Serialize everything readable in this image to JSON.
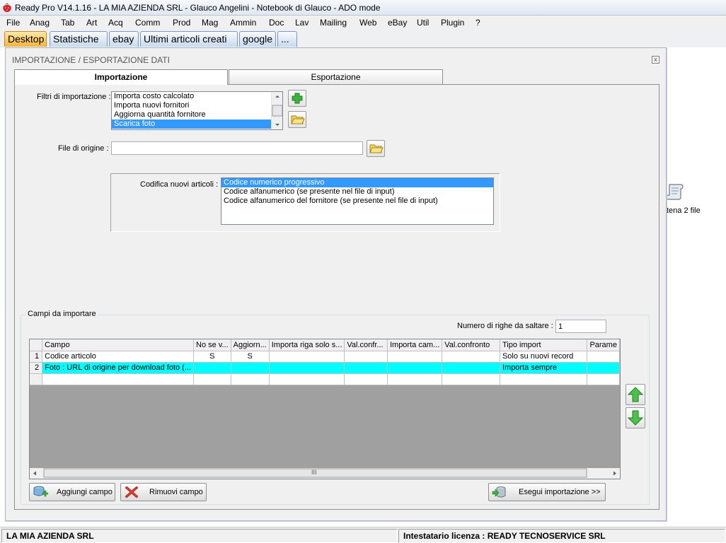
{
  "window": {
    "title": "Ready Pro V14.1.16 - LA MIA AZIENDA SRL - Glauco Angelini - Notebook di Glauco - ADO mode"
  },
  "menu": [
    "File",
    "Anag",
    "Tab",
    "Art",
    "Acq",
    "Comm",
    "Prod",
    "Mag",
    "Ammin",
    "Doc",
    "Lav",
    "Mailing",
    "Web",
    "eBay",
    "Util",
    "Plugin",
    "?"
  ],
  "desktop_tabs": [
    "Desktop",
    "Statistiche",
    "ebay",
    "Ultimi articoli creati",
    "google",
    "..."
  ],
  "desktop_item": {
    "label": "tena 2 file"
  },
  "dialog": {
    "title": "IMPORTAZIONE / ESPORTAZIONE DATI",
    "close": "x",
    "tabs": [
      "Importazione",
      "Esportazione"
    ],
    "filters": {
      "label": "Filtri di importazione :",
      "items": [
        "Importa costo calcolato",
        "Importa nuovi fornitori",
        "Aggiorna quantità fornitore",
        "Scarica foto"
      ],
      "selected": "Scarica foto"
    },
    "source_file": {
      "label": "File di origine :",
      "value": ""
    },
    "encoding": {
      "label": "Codifica nuovi articoli :",
      "options": [
        "Codice numerico progressivo",
        "Codice alfanumerico (se presente nel file di input)",
        "Codice alfanumerico del fornitore (se presente nel file di input)"
      ],
      "selected": "Codice numerico progressivo"
    },
    "fields_group": {
      "caption": "Campi da importare",
      "skip_rows_label": "Numero di righe da saltare  :",
      "skip_rows_value": "1",
      "grid": {
        "columns": [
          "Campo",
          "No se v...",
          "Aggiorn...",
          "Importa riga solo s...",
          "Val.confr...",
          "Importa cam...",
          "Val.confronto",
          "Tipo import",
          "Parame"
        ],
        "rows": [
          {
            "n": "1",
            "cells": [
              "Codice articolo",
              "S",
              "S",
              "",
              "",
              "",
              "",
              "Solo su nuovi record",
              ""
            ]
          },
          {
            "n": "2",
            "cells": [
              "Foto : URL di origine per download foto (...",
              "",
              "",
              "",
              "",
              "",
              "",
              "Importa sempre",
              ""
            ]
          }
        ],
        "scroll_grip": "III"
      },
      "buttons": {
        "add": "Aggiungi campo",
        "remove": "Rimuovi campo",
        "run": "Esegui importazione >>"
      }
    }
  },
  "statusbar": {
    "left": "LA MIA AZIENDA SRL",
    "right": "Intestatario licenza : READY TECNOSERVICE SRL"
  },
  "colors": {
    "selection": "#3399ff",
    "grid_highlight": "#00ffff",
    "active_tab": "#f6b33a"
  }
}
